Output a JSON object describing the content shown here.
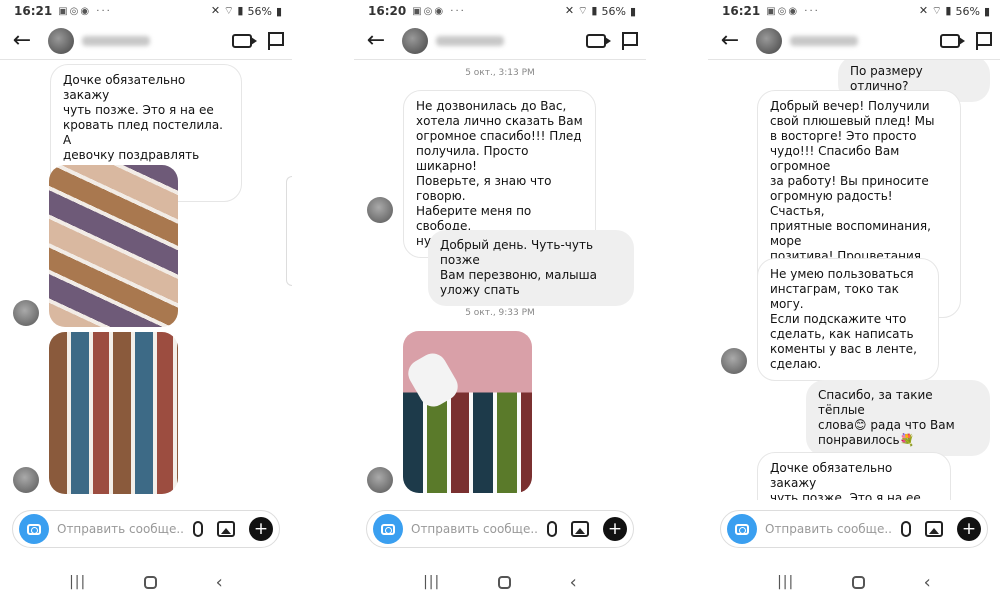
{
  "screens": [
    {
      "status": {
        "time": "16:21",
        "battery": "56%"
      },
      "messages": {
        "m1": "Дочке обязательно закажу\nчуть позже. Это я на ее\nкровать плед постелила. А\nдевочку поздравлять позже\nподем."
      },
      "composer": {
        "placeholder": "Отправить сообще..."
      }
    },
    {
      "status": {
        "time": "16:20",
        "battery": "56%"
      },
      "timestamps": {
        "t1": "5 окт., 3:13 PM",
        "t2": "5 окт., 9:33 PM"
      },
      "messages": {
        "m1": "Не дозвонилась до Вас,\nхотела лично сказать Вам\nогромное спасибо!!! Плед\nполучила. Просто шикарно!\nПоверьте, я знаю что говорю.\nНаберите меня по свободе,\nнужно поговорить🙏",
        "m2": "Добрый день. Чуть-чуть позже\nВам перезвоню, малыша\nуложу спать"
      },
      "composer": {
        "placeholder": "Отправить сообще..."
      }
    },
    {
      "status": {
        "time": "16:21",
        "battery": "56%"
      },
      "messages": {
        "m0": "По размеру отлично?",
        "m1": "Добрый вечер! Получили\nсвой плюшевый плед! Мы\nв  восторге! Это просто\nчудо!!! Спасибо Вам огромное\nза работу! Вы приносите\nогромную радость! Счастья,\nприятные воспоминания, море\nпозитива! Процветания Вам и\nвсего самого наилучшего!!!!",
        "m2": "Не умею пользоваться\nинстаграм, токо так могу.\nЕсли подскажите что\nсделать, как написать\nкоменты у вас в ленте,\nсделаю.",
        "m3": "Спасибо, за такие тёплые\nслова😊 рада что Вам\nпонравилось💐",
        "m4": "Дочке обязательно закажу\nчуть позже. Это я на ее\nкровать плед постелила. А"
      },
      "composer": {
        "placeholder": "Отправить сообще..."
      }
    }
  ],
  "icons": {
    "back": "arrow-left",
    "video": "video-camera",
    "flag": "flag",
    "camera": "camera",
    "mic": "microphone",
    "gallery": "image",
    "plus": "plus"
  },
  "colors": {
    "accent": "#3a9ff0",
    "outgoing_bubble": "#efefef",
    "incoming_border": "#e6e6e6"
  },
  "symbols": {
    "back_arrow": "←",
    "plus": "+",
    "recents": "|||",
    "nav_back": "‹"
  }
}
